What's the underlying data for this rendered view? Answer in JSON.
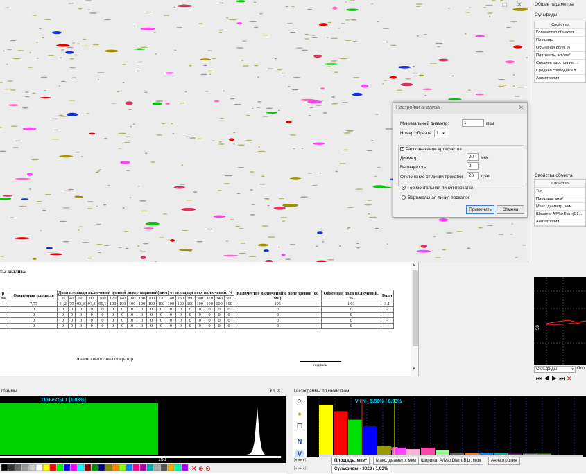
{
  "dialog": {
    "title": "Настройки анализа",
    "min_diameter_label": "Минимальный диаметр:",
    "min_diameter_value": "1",
    "min_diameter_unit": "мкм",
    "sample_label": "Номер образца:",
    "sample_value": "1",
    "artifact_label": "Распознавание артефактов",
    "artifact_checked": true,
    "diameter_label": "Диаметр",
    "diameter_value": "20",
    "diameter_unit": "мкм",
    "elongation_label": "Вытянутость",
    "elongation_value": "2",
    "deviation_label": "Отклонение от линии прокатки",
    "deviation_value": "20",
    "deviation_unit": "град.",
    "radio_horizontal": "Горизонтальная линия прокатки",
    "radio_vertical": "Вертикальная линия прокатки",
    "apply": "Применить",
    "cancel": "Отмена"
  },
  "report": {
    "title": "ты анализа:",
    "col_number": "р\nца",
    "col_area": "Оцененная площадь",
    "col_share": "Доля площади включений длиной менее заданной(мкм) от площади всех включений, %",
    "col_count": "Количество включений в поле зрения (80 мм)",
    "col_volume": "Объемная доля включений, %",
    "col_score": "Балл",
    "lengths": [
      "20",
      "40",
      "60",
      "80",
      "100",
      "120",
      "140",
      "160",
      "180",
      "200",
      "220",
      "240",
      "260",
      "280",
      "300",
      "320",
      "340",
      "360"
    ],
    "rows": [
      {
        "area": "7,77",
        "shares": [
          "41,2",
          "79",
          "93,3",
          "97,3",
          "99,1",
          "100",
          "100",
          "100",
          "100",
          "100",
          "100",
          "100",
          "100",
          "100",
          "100",
          "100",
          "100",
          "100"
        ],
        "count": "195",
        "volume": "1,03",
        "score": "3.1"
      },
      {
        "area": "0",
        "shares": [
          "0",
          "0",
          "0",
          "0",
          "0",
          "0",
          "0",
          "0",
          "0",
          "0",
          "0",
          "0",
          "0",
          "0",
          "0",
          "0",
          "0",
          "0"
        ],
        "count": "0",
        "volume": "0",
        "score": "-"
      },
      {
        "area": "0",
        "shares": [
          "0",
          "0",
          "0",
          "0",
          "0",
          "0",
          "0",
          "0",
          "0",
          "0",
          "0",
          "0",
          "0",
          "0",
          "0",
          "0",
          "0",
          "0"
        ],
        "count": "0",
        "volume": "0",
        "score": "-"
      },
      {
        "area": "0",
        "shares": [
          "0",
          "0",
          "0",
          "0",
          "0",
          "0",
          "0",
          "0",
          "0",
          "0",
          "0",
          "0",
          "0",
          "0",
          "0",
          "0",
          "0",
          "0"
        ],
        "count": "0",
        "volume": "0",
        "score": "-"
      },
      {
        "area": "0",
        "shares": [
          "0",
          "0",
          "0",
          "0",
          "0",
          "0",
          "0",
          "0",
          "0",
          "0",
          "0",
          "0",
          "0",
          "0",
          "0",
          "0",
          "0",
          "0"
        ],
        "count": "0",
        "volume": "0",
        "score": "-"
      }
    ],
    "operator": "Анализ выполнил оператор",
    "signature": "подпись"
  },
  "right_panel": {
    "general_title": "Общие параметры",
    "general_filter": "Сульфиды",
    "general_header": "Свойство",
    "general_props": [
      "Количество объектов",
      "Площадь",
      "Объёмная доля, %",
      "Плотность, шт./мм²",
      "Среднее расстояние, ...",
      "Средний свободный п...",
      "Анизотропия"
    ],
    "object_title": "Свойства объекта",
    "object_header": "Свойство",
    "object_props": [
      "Тип",
      "Площадь, мкм²",
      "Макс. диаметр, мкм",
      "Ширина, A/MaxDiam(B1...",
      "Анизотропия"
    ],
    "osc_axis_label": "50",
    "osc_dropdown": "Сульфиды",
    "osc_dropdown2": "Пло",
    "nav": [
      "⏮",
      "◀",
      "▶",
      "⏭"
    ]
  },
  "hist_left": {
    "title": "граммы",
    "ctrls": "▾ ᵠ ✕",
    "label": "Объекты 1 [1,03%]",
    "value_label": "153",
    "chart_data": {
      "type": "bar",
      "categories": [
        "Объекты 1"
      ],
      "values": [
        1.03
      ],
      "title": "Объекты 1 [1,03%]"
    }
  },
  "hist_right": {
    "title": "Гистограммы по свойствам",
    "label": "V / N : 5,59% / 0,93%",
    "marker_left": "142",
    "marker_right": "177",
    "tool_n": "N",
    "tool_v": "V",
    "tabs": [
      "Площадь, мкм²",
      "Макс. диаметр, мкм",
      "Ширина, A/MaxDiam(B1), мкм",
      "Анизотропия"
    ],
    "tab2": "Сульфиды - 3023 / 1,03%",
    "chart_data": {
      "type": "bar",
      "values": [
        100,
        87,
        70,
        57,
        17,
        14,
        11,
        14,
        9,
        3,
        4,
        3,
        3,
        2,
        2,
        2
      ],
      "colors": [
        "#ffff00",
        "#ff0000",
        "#00e000",
        "#0000ff",
        "#9a9a00",
        "#ff44ff",
        "#ffb0d8",
        "#ff44aa",
        "#90ff90",
        "#606060",
        "#ff7a00",
        "#0088ff",
        "#00aaaa",
        "#aa00aa",
        "#888888",
        "#55aa00"
      ],
      "title": "V / N : 5,59% / 0,93%"
    }
  }
}
